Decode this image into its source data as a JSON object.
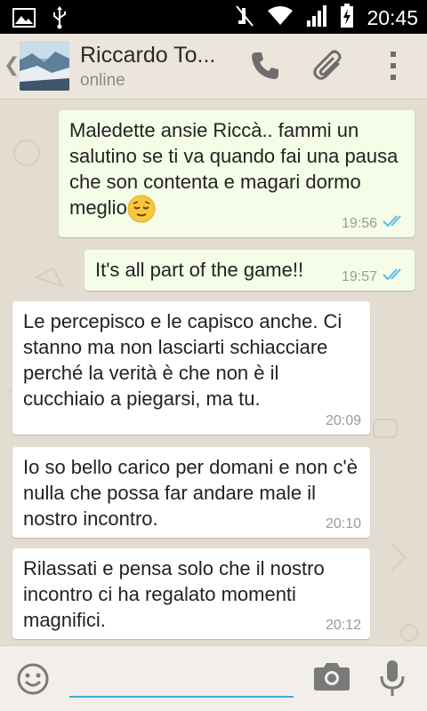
{
  "status_bar": {
    "time": "20:45",
    "icons": [
      "image-icon",
      "usb-icon",
      "mute-icon",
      "wifi-icon",
      "signal-icon",
      "battery-charging-icon"
    ]
  },
  "header": {
    "back_glyph": "❮",
    "contact_name": "Riccardo To...",
    "contact_status": "online",
    "icons": [
      "phone-icon",
      "attach-icon",
      "overflow-menu-icon"
    ]
  },
  "messages": [
    {
      "direction": "out",
      "text": "Maledette ansie Riccà..  fammi un salutino se ti va quando fai una pausa che son contenta e magari dormo meglio",
      "emoji": "relieved-face",
      "time": "19:56",
      "status": "read"
    },
    {
      "direction": "out",
      "text": "It's all part of the game!!",
      "time": "19:57",
      "status": "read"
    },
    {
      "direction": "in",
      "text": "Le percepisco e le capisco anche. Ci stanno ma non lasciarti schiacciare perché la verità è che non è il cucchiaio a piegarsi, ma tu.",
      "time": "20:09"
    },
    {
      "direction": "in",
      "text": "Io so bello carico per domani e non c'è nulla che possa far andare male il nostro incontro.",
      "time": "20:10"
    },
    {
      "direction": "in",
      "text": "Rilassati e pensa solo che il nostro incontro ci ha regalato momenti magnifici.",
      "time": "20:12"
    }
  ],
  "composer": {
    "value": "",
    "placeholder": ""
  },
  "colors": {
    "outgoing_bubble": "#f5fde8",
    "incoming_bubble": "#ffffff",
    "read_ticks": "#5cb8e6",
    "input_underline": "#34b0d8",
    "chat_background": "#e3dcd1"
  }
}
